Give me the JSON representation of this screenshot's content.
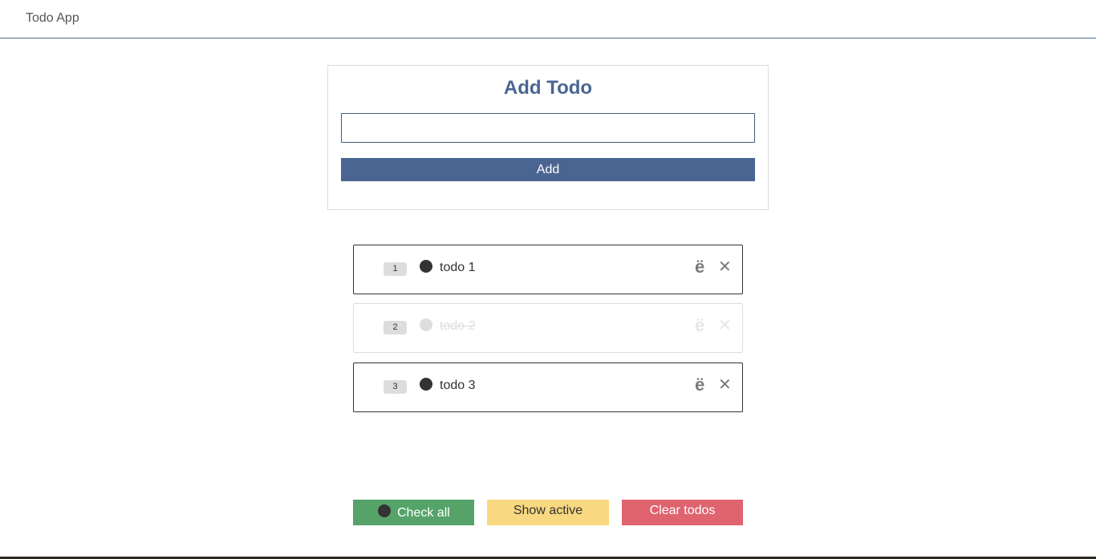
{
  "app": {
    "brand": "Todo App"
  },
  "add_form": {
    "title": "Add Todo",
    "input_value": "",
    "add_label": "Add"
  },
  "todos": [
    {
      "index": "1",
      "text": "todo 1",
      "completed": false,
      "edit_icon": "ë",
      "delete_icon": "✕"
    },
    {
      "index": "2",
      "text": "todo 2",
      "completed": true,
      "edit_icon": "ë",
      "delete_icon": "✕"
    },
    {
      "index": "3",
      "text": "todo 3",
      "completed": false,
      "edit_icon": "ë",
      "delete_icon": "✕"
    }
  ],
  "footer": {
    "check_all_label": "Check all",
    "show_active_label": "Show active",
    "clear_label": "Clear todos"
  },
  "colors": {
    "primary": "#4a6592",
    "success": "#56a36a",
    "warning": "#f8d880",
    "danger": "#df6470"
  }
}
